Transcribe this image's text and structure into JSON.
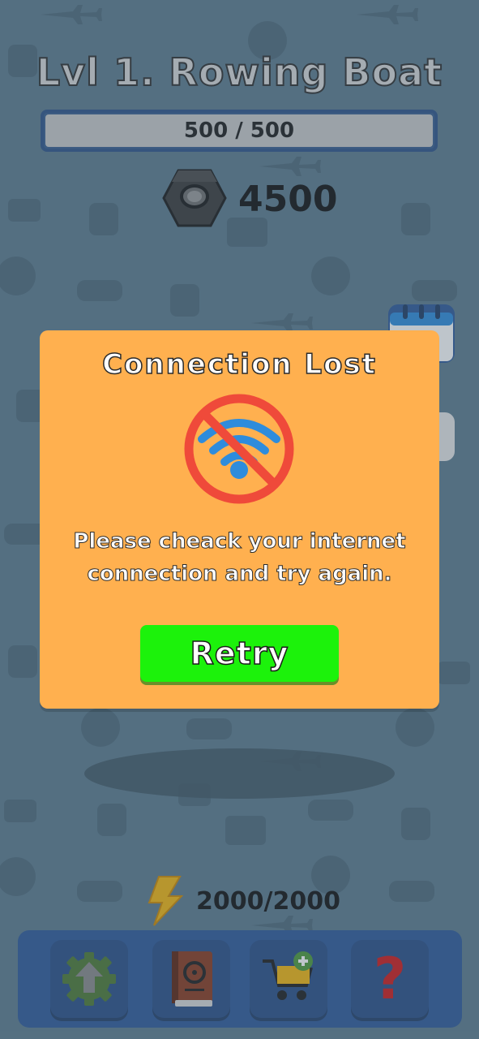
{
  "level": {
    "title": "Lvl 1. Rowing Boat"
  },
  "xp": {
    "text": "500 / 500",
    "fraction": 1.0
  },
  "coins": {
    "value": "4500",
    "icon": "hex-nut-icon"
  },
  "dialog": {
    "title": "Connection Lost",
    "icon": "no-wifi-icon",
    "message_line1": "Please cheack your internet",
    "message_line2": "connection and try again.",
    "retry_label": "Retry"
  },
  "energy": {
    "value": "2000/2000",
    "icon": "lightning-icon"
  },
  "bottom_nav": [
    {
      "icon": "upgrade-gear-icon"
    },
    {
      "icon": "book-icon"
    },
    {
      "icon": "cart-add-icon"
    },
    {
      "icon": "help-icon"
    }
  ],
  "colors": {
    "background": "#5d7c8e",
    "modal": "#ffb04f",
    "retry_button": "#1cf20b",
    "bottom_bar": "#2f5a9a",
    "no_wifi_circle": "#ef4a3a",
    "wifi": "#2e8cdc"
  }
}
